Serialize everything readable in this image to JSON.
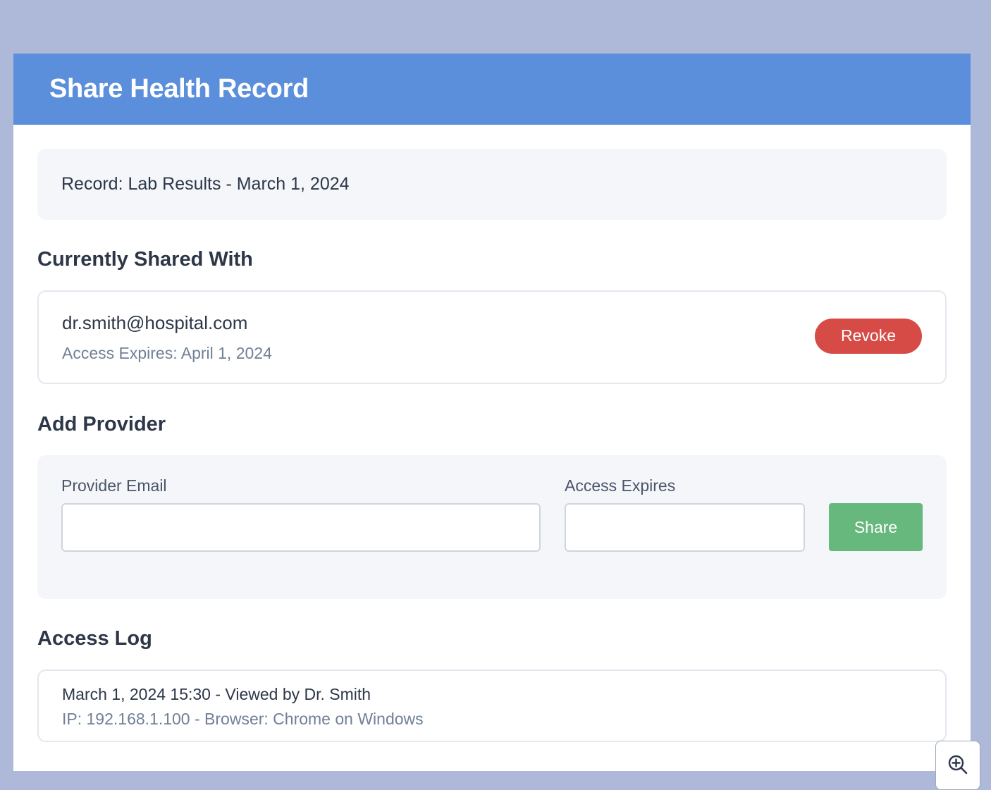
{
  "header": {
    "title": "Share Health Record"
  },
  "record": {
    "label": "Record: Lab Results - March 1, 2024"
  },
  "shared_section": {
    "title": "Currently Shared With",
    "items": [
      {
        "email": "dr.smith@hospital.com",
        "expires": "Access Expires: April 1, 2024",
        "revoke_label": "Revoke"
      }
    ]
  },
  "add_provider": {
    "title": "Add Provider",
    "email_label": "Provider Email",
    "email_value": "",
    "expires_label": "Access Expires",
    "expires_value": "",
    "share_label": "Share"
  },
  "access_log": {
    "title": "Access Log",
    "entries": [
      {
        "main": "March 1, 2024 15:30 - Viewed by Dr. Smith",
        "detail": "IP: 192.168.1.100 - Browser: Chrome on Windows"
      }
    ]
  },
  "icons": {
    "zoom": "zoom-in-icon"
  },
  "colors": {
    "header": "#5b8fdc",
    "revoke": "#d64b45",
    "share": "#66b87c",
    "background": "#aeb8d8"
  }
}
